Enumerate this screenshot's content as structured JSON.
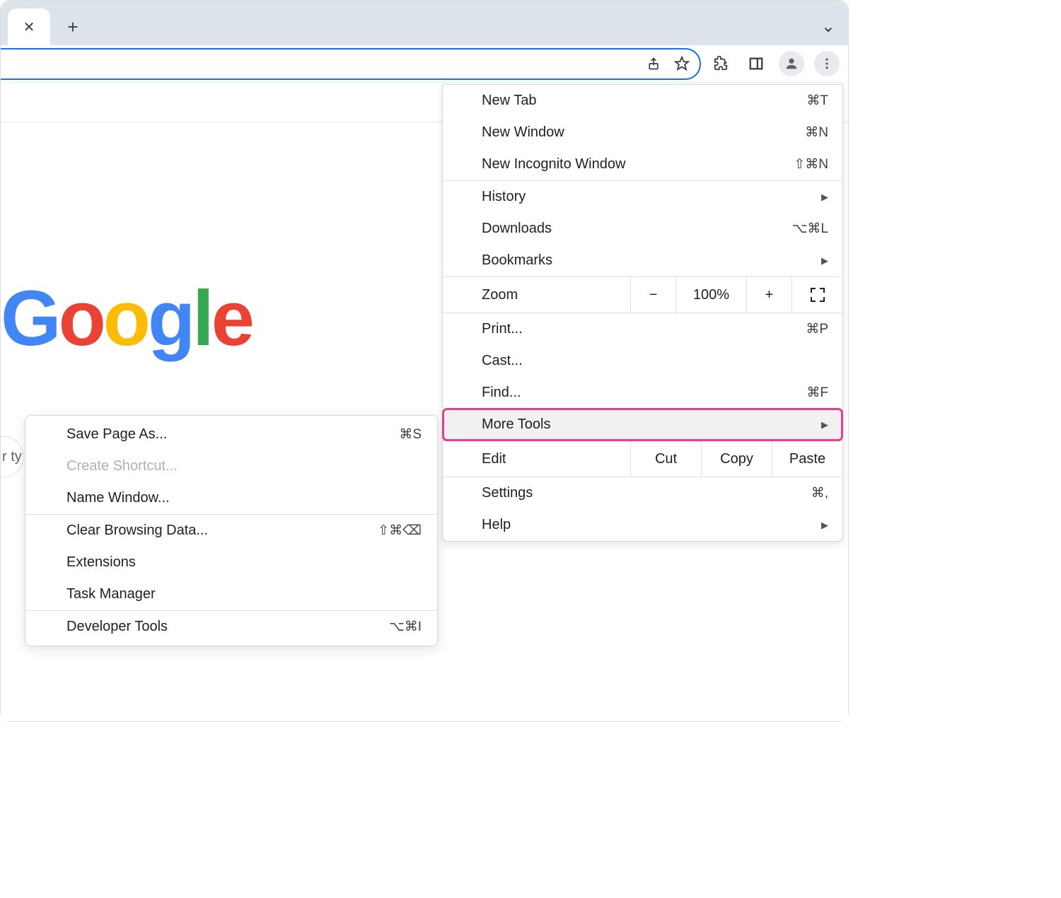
{
  "toolbar": {
    "icons": {
      "share": "share-icon",
      "star": "star-icon",
      "extensions": "puzzle-icon",
      "side_panel": "sidepanel-icon",
      "profile": "profile-icon",
      "more": "more-vert-icon"
    }
  },
  "page": {
    "logo_text": "Google",
    "search_fragment": "r ty"
  },
  "menu": {
    "new_tab": {
      "label": "New Tab",
      "shortcut": "⌘T"
    },
    "new_window": {
      "label": "New Window",
      "shortcut": "⌘N"
    },
    "new_incognito": {
      "label": "New Incognito Window",
      "shortcut": "⇧⌘N"
    },
    "history": {
      "label": "History"
    },
    "downloads": {
      "label": "Downloads",
      "shortcut": "⌥⌘L"
    },
    "bookmarks": {
      "label": "Bookmarks"
    },
    "zoom": {
      "label": "Zoom",
      "minus": "−",
      "pct": "100%",
      "plus": "+"
    },
    "print": {
      "label": "Print...",
      "shortcut": "⌘P"
    },
    "cast": {
      "label": "Cast..."
    },
    "find": {
      "label": "Find...",
      "shortcut": "⌘F"
    },
    "more_tools": {
      "label": "More Tools"
    },
    "edit": {
      "label": "Edit",
      "cut": "Cut",
      "copy": "Copy",
      "paste": "Paste"
    },
    "settings": {
      "label": "Settings",
      "shortcut": "⌘,"
    },
    "help": {
      "label": "Help"
    }
  },
  "submenu": {
    "save_page": {
      "label": "Save Page As...",
      "shortcut": "⌘S"
    },
    "create_shortcut": {
      "label": "Create Shortcut..."
    },
    "name_window": {
      "label": "Name Window..."
    },
    "clear_browsing": {
      "label": "Clear Browsing Data...",
      "shortcut": "⇧⌘⌫"
    },
    "extensions": {
      "label": "Extensions"
    },
    "task_manager": {
      "label": "Task Manager"
    },
    "developer_tools": {
      "label": "Developer Tools",
      "shortcut": "⌥⌘I"
    }
  }
}
